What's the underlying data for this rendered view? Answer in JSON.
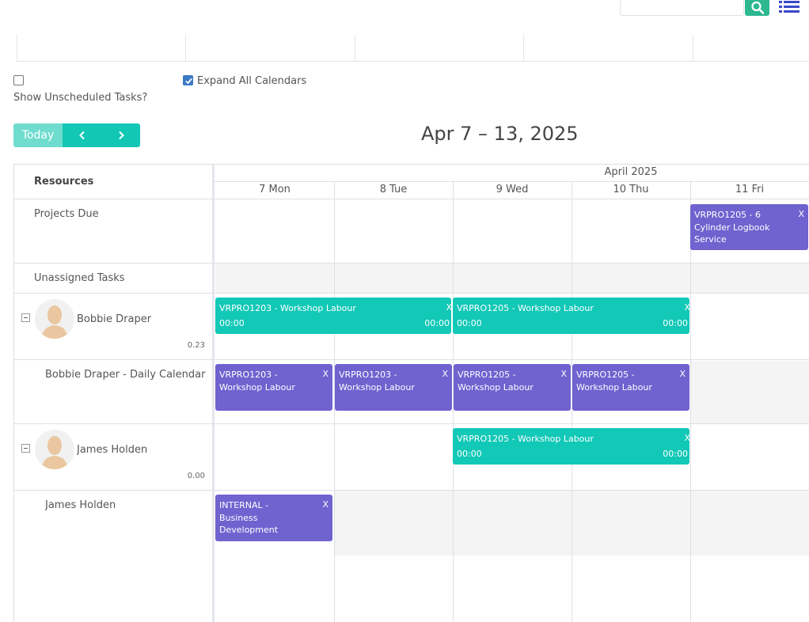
{
  "toolbar": {
    "search_placeholder": "",
    "search_icon": "search-icon",
    "list_icon": "list-icon"
  },
  "filters": {
    "show_unscheduled_label": "Show Unscheduled Tasks?",
    "show_unscheduled_checked": false,
    "expand_all_label": "Expand All Calendars",
    "expand_all_checked": true
  },
  "navigation": {
    "today_label": "Today",
    "prev_icon": "chevron-left-icon",
    "next_icon": "chevron-right-icon"
  },
  "calendar": {
    "range_title": "Apr 7 – 13, 2025",
    "resources_header": "Resources",
    "month_label": "April 2025",
    "days": [
      "7 Mon",
      "8 Tue",
      "9 Wed",
      "10 Thu",
      "11 Fri"
    ]
  },
  "rows": {
    "projects_due": "Projects Due",
    "unassigned": "Unassigned Tasks",
    "bobbie": {
      "name": "Bobbie Draper",
      "utilization": "0.23"
    },
    "bobbie_daily": "Bobbie Draper - Daily Calendar",
    "james": {
      "name": "James Holden",
      "utilization": "0.00"
    },
    "james_cal": "James Holden"
  },
  "events": {
    "projects_due_fri": {
      "title": "VRPRO1205 - 6 Cylinder Logbook Service",
      "close": "X"
    },
    "bobbie_teal_1": {
      "title": "VRPRO1203 - Workshop Labour",
      "start": "00:00",
      "end": "00:00",
      "close": "X"
    },
    "bobbie_teal_2": {
      "title": "VRPRO1205 - Workshop Labour",
      "start": "00:00",
      "end": "00:00",
      "close": "X"
    },
    "daily_mon": {
      "title": "VRPRO1203 - Workshop Labour",
      "close": "X"
    },
    "daily_tue": {
      "title": "VRPRO1203 - Workshop Labour",
      "close": "X"
    },
    "daily_wed": {
      "title": "VRPRO1205 - Workshop Labour",
      "close": "X"
    },
    "daily_thu": {
      "title": "VRPRO1205 - Workshop Labour",
      "close": "X"
    },
    "james_teal": {
      "title": "VRPRO1205 - Workshop Labour",
      "start": "00:00",
      "end": "00:00",
      "close": "X"
    },
    "james_mon": {
      "title": "INTERNAL - Business Development",
      "close": "X"
    }
  },
  "colors": {
    "teal_event": "#12c8b7",
    "purple_event": "#7062cf",
    "search_button": "#2db892",
    "list_icon": "#3a48c8",
    "today_button": "#6fdccf",
    "nav_button": "#13c7b5",
    "checkbox_checked": "#3c7ac4"
  }
}
